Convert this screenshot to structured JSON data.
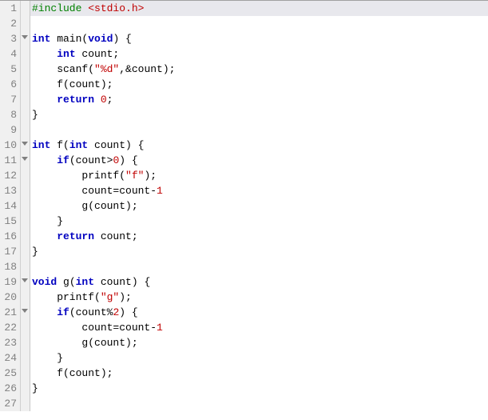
{
  "lines": [
    {
      "n": 1,
      "fold": false,
      "hl": true,
      "tokens": [
        {
          "c": "pp",
          "t": "#include "
        },
        {
          "c": "inc",
          "t": "<stdio.h>"
        }
      ]
    },
    {
      "n": 2,
      "fold": false,
      "hl": false,
      "tokens": []
    },
    {
      "n": 3,
      "fold": true,
      "hl": false,
      "tokens": [
        {
          "c": "typ",
          "t": "int"
        },
        {
          "c": "",
          "t": " main("
        },
        {
          "c": "typ",
          "t": "void"
        },
        {
          "c": "",
          "t": ") {"
        }
      ]
    },
    {
      "n": 4,
      "fold": false,
      "hl": false,
      "tokens": [
        {
          "c": "",
          "t": "    "
        },
        {
          "c": "typ",
          "t": "int"
        },
        {
          "c": "",
          "t": " count;"
        }
      ]
    },
    {
      "n": 5,
      "fold": false,
      "hl": false,
      "tokens": [
        {
          "c": "",
          "t": "    scanf("
        },
        {
          "c": "str",
          "t": "\"%d\""
        },
        {
          "c": "",
          "t": ",&count);"
        }
      ]
    },
    {
      "n": 6,
      "fold": false,
      "hl": false,
      "tokens": [
        {
          "c": "",
          "t": "    f(count);"
        }
      ]
    },
    {
      "n": 7,
      "fold": false,
      "hl": false,
      "tokens": [
        {
          "c": "",
          "t": "    "
        },
        {
          "c": "kw",
          "t": "return"
        },
        {
          "c": "",
          "t": " "
        },
        {
          "c": "num",
          "t": "0"
        },
        {
          "c": "",
          "t": ";"
        }
      ]
    },
    {
      "n": 8,
      "fold": false,
      "hl": false,
      "tokens": [
        {
          "c": "",
          "t": "}"
        }
      ]
    },
    {
      "n": 9,
      "fold": false,
      "hl": false,
      "tokens": []
    },
    {
      "n": 10,
      "fold": true,
      "hl": false,
      "tokens": [
        {
          "c": "typ",
          "t": "int"
        },
        {
          "c": "",
          "t": " f("
        },
        {
          "c": "typ",
          "t": "int"
        },
        {
          "c": "",
          "t": " count) {"
        }
      ]
    },
    {
      "n": 11,
      "fold": true,
      "hl": false,
      "tokens": [
        {
          "c": "",
          "t": "    "
        },
        {
          "c": "kw",
          "t": "if"
        },
        {
          "c": "",
          "t": "(count>"
        },
        {
          "c": "num",
          "t": "0"
        },
        {
          "c": "",
          "t": ") {"
        }
      ]
    },
    {
      "n": 12,
      "fold": false,
      "hl": false,
      "tokens": [
        {
          "c": "",
          "t": "        printf("
        },
        {
          "c": "str",
          "t": "\"f\""
        },
        {
          "c": "",
          "t": ");"
        }
      ]
    },
    {
      "n": 13,
      "fold": false,
      "hl": false,
      "tokens": [
        {
          "c": "",
          "t": "        count=count-"
        },
        {
          "c": "num",
          "t": "1"
        }
      ]
    },
    {
      "n": 14,
      "fold": false,
      "hl": false,
      "tokens": [
        {
          "c": "",
          "t": "        g(count);"
        }
      ]
    },
    {
      "n": 15,
      "fold": false,
      "hl": false,
      "tokens": [
        {
          "c": "",
          "t": "    }"
        }
      ]
    },
    {
      "n": 16,
      "fold": false,
      "hl": false,
      "tokens": [
        {
          "c": "",
          "t": "    "
        },
        {
          "c": "kw",
          "t": "return"
        },
        {
          "c": "",
          "t": " count;"
        }
      ]
    },
    {
      "n": 17,
      "fold": false,
      "hl": false,
      "tokens": [
        {
          "c": "",
          "t": "}"
        }
      ]
    },
    {
      "n": 18,
      "fold": false,
      "hl": false,
      "tokens": []
    },
    {
      "n": 19,
      "fold": true,
      "hl": false,
      "tokens": [
        {
          "c": "typ",
          "t": "void"
        },
        {
          "c": "",
          "t": " g("
        },
        {
          "c": "typ",
          "t": "int"
        },
        {
          "c": "",
          "t": " count) {"
        }
      ]
    },
    {
      "n": 20,
      "fold": false,
      "hl": false,
      "tokens": [
        {
          "c": "",
          "t": "    printf("
        },
        {
          "c": "str",
          "t": "\"g\""
        },
        {
          "c": "",
          "t": ");"
        }
      ]
    },
    {
      "n": 21,
      "fold": true,
      "hl": false,
      "tokens": [
        {
          "c": "",
          "t": "    "
        },
        {
          "c": "kw",
          "t": "if"
        },
        {
          "c": "",
          "t": "(count%"
        },
        {
          "c": "num",
          "t": "2"
        },
        {
          "c": "",
          "t": ") {"
        }
      ]
    },
    {
      "n": 22,
      "fold": false,
      "hl": false,
      "tokens": [
        {
          "c": "",
          "t": "        count=count-"
        },
        {
          "c": "num",
          "t": "1"
        }
      ]
    },
    {
      "n": 23,
      "fold": false,
      "hl": false,
      "tokens": [
        {
          "c": "",
          "t": "        g(count);"
        }
      ]
    },
    {
      "n": 24,
      "fold": false,
      "hl": false,
      "tokens": [
        {
          "c": "",
          "t": "    }"
        }
      ]
    },
    {
      "n": 25,
      "fold": false,
      "hl": false,
      "tokens": [
        {
          "c": "",
          "t": "    f(count);"
        }
      ]
    },
    {
      "n": 26,
      "fold": false,
      "hl": false,
      "tokens": [
        {
          "c": "",
          "t": "}"
        }
      ]
    },
    {
      "n": 27,
      "fold": false,
      "hl": false,
      "tokens": []
    }
  ]
}
